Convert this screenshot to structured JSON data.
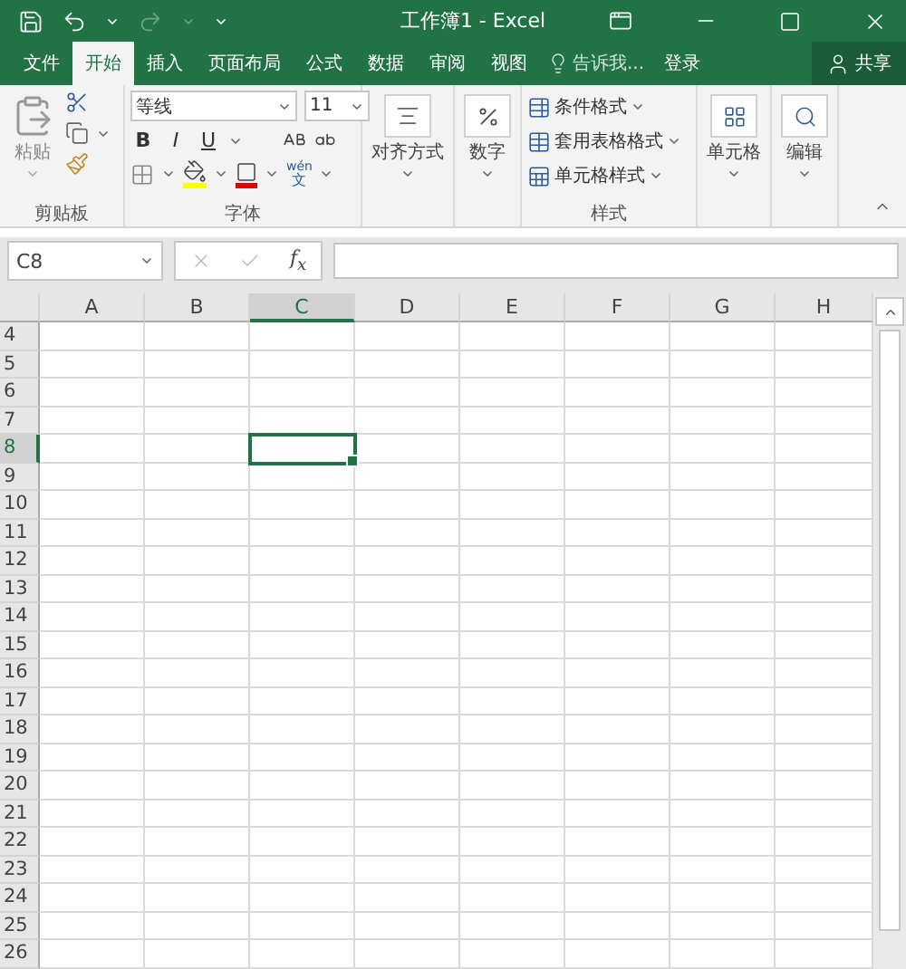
{
  "window": {
    "title": "工作簿1 - Excel"
  },
  "tabs": [
    {
      "label": "文件",
      "selected": false
    },
    {
      "label": "开始",
      "selected": true
    },
    {
      "label": "插入",
      "selected": false
    },
    {
      "label": "页面布局",
      "selected": false
    },
    {
      "label": "公式",
      "selected": false
    },
    {
      "label": "数据",
      "selected": false
    },
    {
      "label": "审阅",
      "selected": false
    },
    {
      "label": "视图",
      "selected": false
    }
  ],
  "tell_me": {
    "placeholder": "告诉我..."
  },
  "sign_in": "登录",
  "share": "共享",
  "ribbon": {
    "clipboard": {
      "paste": "粘贴",
      "label": "剪贴板"
    },
    "font": {
      "font_name": "等线",
      "font_size": "11",
      "bold": "B",
      "italic": "I",
      "underline": "U",
      "phonetic": [
        "wén",
        "文"
      ],
      "label": "字体"
    },
    "alignment": "对齐方式",
    "number": "数字",
    "styles": {
      "items": [
        "条件格式",
        "套用表格格式",
        "单元格样式"
      ],
      "label": "样式"
    },
    "cells": "单元格",
    "editing": "编辑"
  },
  "formula_bar": {
    "name_box": "C8",
    "function_label": "f$_{x}$"
  },
  "columns": [
    {
      "label": "A",
      "selected": false
    },
    {
      "label": "B",
      "selected": false
    },
    {
      "label": "C",
      "selected": true
    },
    {
      "label": "D",
      "selected": false
    },
    {
      "label": "E",
      "selected": false
    },
    {
      "label": "F",
      "selected": false
    },
    {
      "label": "G",
      "selected": false
    },
    {
      "label": "H",
      "selected": false
    }
  ],
  "rows": [
    {
      "label": "4",
      "selected": false
    },
    {
      "label": "5",
      "selected": false
    },
    {
      "label": "6",
      "selected": false
    },
    {
      "label": "7",
      "selected": false
    },
    {
      "label": "8",
      "selected": true
    },
    {
      "label": "9",
      "selected": false
    },
    {
      "label": "10",
      "selected": false
    },
    {
      "label": "11",
      "selected": false
    },
    {
      "label": "12",
      "selected": false
    },
    {
      "label": "13",
      "selected": false
    },
    {
      "label": "14",
      "selected": false
    },
    {
      "label": "15",
      "selected": false
    },
    {
      "label": "16",
      "selected": false
    },
    {
      "label": "17",
      "selected": false
    },
    {
      "label": "18",
      "selected": false
    },
    {
      "label": "19",
      "selected": false
    },
    {
      "label": "20",
      "selected": false
    },
    {
      "label": "21",
      "selected": false
    },
    {
      "label": "22",
      "selected": false
    },
    {
      "label": "23",
      "selected": false
    },
    {
      "label": "24",
      "selected": false
    },
    {
      "label": "25",
      "selected": false
    },
    {
      "label": "26",
      "selected": false
    }
  ]
}
